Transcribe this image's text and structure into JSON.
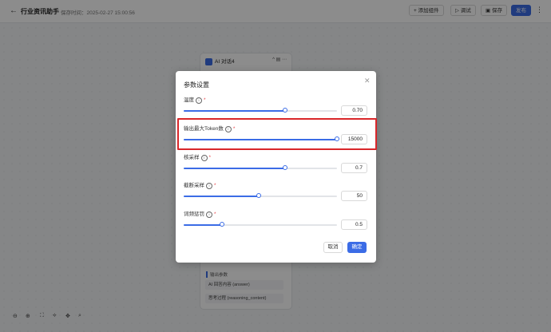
{
  "header": {
    "back_icon": "arrow-left-icon",
    "title": "行业资讯助手",
    "save_time": "保存时间：2025-02-27 15:00:56",
    "add_component": "+ 添加组件",
    "debug": "▷ 调试",
    "save": "保存",
    "publish": "发布"
  },
  "node": {
    "title": "AI 对话4",
    "output_title": "输出参数",
    "outputs": [
      "AI 回答内容 (answer)",
      "思考过程 (reasoning_content)"
    ]
  },
  "dialog": {
    "title": "参数设置",
    "params": [
      {
        "label": "温度",
        "value": "0.70",
        "fraction": 0.66
      },
      {
        "label": "输出最大Token数",
        "value": "15000",
        "fraction": 1.0
      },
      {
        "label": "核采样",
        "value": "0.7",
        "fraction": 0.66
      },
      {
        "label": "截断采样",
        "value": "50",
        "fraction": 0.49
      },
      {
        "label": "词频惩罚",
        "value": "0.5",
        "fraction": 0.25
      }
    ],
    "cancel": "取消",
    "ok": "确定"
  },
  "colors": {
    "accent": "#3b6ce6",
    "highlight": "#d9262a"
  }
}
